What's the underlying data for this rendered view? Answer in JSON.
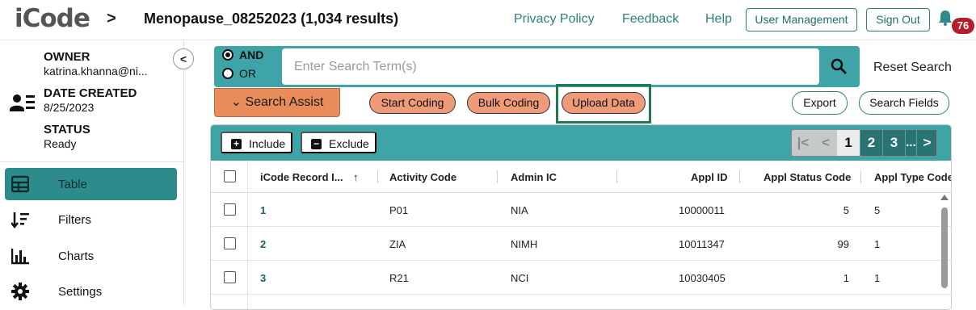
{
  "header": {
    "logo": "iCode",
    "title": "Menopause_08252023 (1,034 results)",
    "links": [
      "Privacy Policy",
      "Feedback",
      "Help"
    ],
    "user_management": "User Management",
    "sign_out": "Sign Out",
    "notification_count": "76"
  },
  "sidebar": {
    "owner_label": "OWNER",
    "owner_value": "katrina.khanna@ni...",
    "date_label": "DATE CREATED",
    "date_value": "8/25/2023",
    "status_label": "STATUS",
    "status_value": "Ready",
    "nav": [
      {
        "label": "Table",
        "icon": "table-icon",
        "active": true
      },
      {
        "label": "Filters",
        "icon": "filters-icon",
        "active": false
      },
      {
        "label": "Charts",
        "icon": "charts-icon",
        "active": false
      },
      {
        "label": "Settings",
        "icon": "gear-icon",
        "active": false
      }
    ]
  },
  "search": {
    "and_label": "AND",
    "or_label": "OR",
    "selected": "AND",
    "placeholder": "Enter Search Term(s)",
    "value": "",
    "reset_label": "Reset Search"
  },
  "actions": {
    "search_assist": "Search Assist",
    "start_coding": "Start Coding",
    "bulk_coding": "Bulk Coding",
    "upload_data": "Upload Data",
    "export": "Export",
    "search_fields": "Search Fields"
  },
  "table": {
    "include": "Include",
    "exclude": "Exclude",
    "pager": {
      "current": "1",
      "pages": [
        "2",
        "3"
      ],
      "ellipsis": "..."
    },
    "columns": [
      "iCode Record I...",
      "Activity Code",
      "Admin IC",
      "Appl ID",
      "Appl Status Code",
      "Appl Type Code"
    ],
    "rows": [
      {
        "record": "1",
        "activity": "P01",
        "admin": "NIA",
        "appl_id": "10000011",
        "status": "5",
        "type": "5"
      },
      {
        "record": "2",
        "activity": "ZIA",
        "admin": "NIMH",
        "appl_id": "10011347",
        "status": "99",
        "type": "1"
      },
      {
        "record": "3",
        "activity": "R21",
        "admin": "NCI",
        "appl_id": "10030405",
        "status": "1",
        "type": "1"
      }
    ]
  },
  "colors": {
    "teal": "#3ea4a8",
    "teal_dark": "#2e8b8b",
    "orange": "#e98c5c",
    "highlight": "#1e7a52",
    "badge": "#b21e2b"
  }
}
